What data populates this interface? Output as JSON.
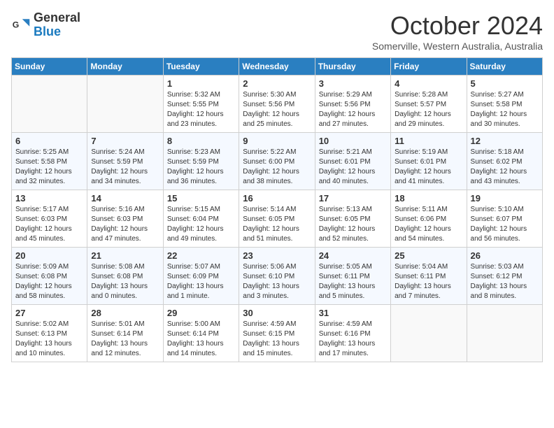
{
  "header": {
    "logo_general": "General",
    "logo_blue": "Blue",
    "month_title": "October 2024",
    "subtitle": "Somerville, Western Australia, Australia"
  },
  "days_of_week": [
    "Sunday",
    "Monday",
    "Tuesday",
    "Wednesday",
    "Thursday",
    "Friday",
    "Saturday"
  ],
  "weeks": [
    [
      {
        "day": "",
        "info": ""
      },
      {
        "day": "",
        "info": ""
      },
      {
        "day": "1",
        "info": "Sunrise: 5:32 AM\nSunset: 5:55 PM\nDaylight: 12 hours and 23 minutes."
      },
      {
        "day": "2",
        "info": "Sunrise: 5:30 AM\nSunset: 5:56 PM\nDaylight: 12 hours and 25 minutes."
      },
      {
        "day": "3",
        "info": "Sunrise: 5:29 AM\nSunset: 5:56 PM\nDaylight: 12 hours and 27 minutes."
      },
      {
        "day": "4",
        "info": "Sunrise: 5:28 AM\nSunset: 5:57 PM\nDaylight: 12 hours and 29 minutes."
      },
      {
        "day": "5",
        "info": "Sunrise: 5:27 AM\nSunset: 5:58 PM\nDaylight: 12 hours and 30 minutes."
      }
    ],
    [
      {
        "day": "6",
        "info": "Sunrise: 5:25 AM\nSunset: 5:58 PM\nDaylight: 12 hours and 32 minutes."
      },
      {
        "day": "7",
        "info": "Sunrise: 5:24 AM\nSunset: 5:59 PM\nDaylight: 12 hours and 34 minutes."
      },
      {
        "day": "8",
        "info": "Sunrise: 5:23 AM\nSunset: 5:59 PM\nDaylight: 12 hours and 36 minutes."
      },
      {
        "day": "9",
        "info": "Sunrise: 5:22 AM\nSunset: 6:00 PM\nDaylight: 12 hours and 38 minutes."
      },
      {
        "day": "10",
        "info": "Sunrise: 5:21 AM\nSunset: 6:01 PM\nDaylight: 12 hours and 40 minutes."
      },
      {
        "day": "11",
        "info": "Sunrise: 5:19 AM\nSunset: 6:01 PM\nDaylight: 12 hours and 41 minutes."
      },
      {
        "day": "12",
        "info": "Sunrise: 5:18 AM\nSunset: 6:02 PM\nDaylight: 12 hours and 43 minutes."
      }
    ],
    [
      {
        "day": "13",
        "info": "Sunrise: 5:17 AM\nSunset: 6:03 PM\nDaylight: 12 hours and 45 minutes."
      },
      {
        "day": "14",
        "info": "Sunrise: 5:16 AM\nSunset: 6:03 PM\nDaylight: 12 hours and 47 minutes."
      },
      {
        "day": "15",
        "info": "Sunrise: 5:15 AM\nSunset: 6:04 PM\nDaylight: 12 hours and 49 minutes."
      },
      {
        "day": "16",
        "info": "Sunrise: 5:14 AM\nSunset: 6:05 PM\nDaylight: 12 hours and 51 minutes."
      },
      {
        "day": "17",
        "info": "Sunrise: 5:13 AM\nSunset: 6:05 PM\nDaylight: 12 hours and 52 minutes."
      },
      {
        "day": "18",
        "info": "Sunrise: 5:11 AM\nSunset: 6:06 PM\nDaylight: 12 hours and 54 minutes."
      },
      {
        "day": "19",
        "info": "Sunrise: 5:10 AM\nSunset: 6:07 PM\nDaylight: 12 hours and 56 minutes."
      }
    ],
    [
      {
        "day": "20",
        "info": "Sunrise: 5:09 AM\nSunset: 6:08 PM\nDaylight: 12 hours and 58 minutes."
      },
      {
        "day": "21",
        "info": "Sunrise: 5:08 AM\nSunset: 6:08 PM\nDaylight: 13 hours and 0 minutes."
      },
      {
        "day": "22",
        "info": "Sunrise: 5:07 AM\nSunset: 6:09 PM\nDaylight: 13 hours and 1 minute."
      },
      {
        "day": "23",
        "info": "Sunrise: 5:06 AM\nSunset: 6:10 PM\nDaylight: 13 hours and 3 minutes."
      },
      {
        "day": "24",
        "info": "Sunrise: 5:05 AM\nSunset: 6:11 PM\nDaylight: 13 hours and 5 minutes."
      },
      {
        "day": "25",
        "info": "Sunrise: 5:04 AM\nSunset: 6:11 PM\nDaylight: 13 hours and 7 minutes."
      },
      {
        "day": "26",
        "info": "Sunrise: 5:03 AM\nSunset: 6:12 PM\nDaylight: 13 hours and 8 minutes."
      }
    ],
    [
      {
        "day": "27",
        "info": "Sunrise: 5:02 AM\nSunset: 6:13 PM\nDaylight: 13 hours and 10 minutes."
      },
      {
        "day": "28",
        "info": "Sunrise: 5:01 AM\nSunset: 6:14 PM\nDaylight: 13 hours and 12 minutes."
      },
      {
        "day": "29",
        "info": "Sunrise: 5:00 AM\nSunset: 6:14 PM\nDaylight: 13 hours and 14 minutes."
      },
      {
        "day": "30",
        "info": "Sunrise: 4:59 AM\nSunset: 6:15 PM\nDaylight: 13 hours and 15 minutes."
      },
      {
        "day": "31",
        "info": "Sunrise: 4:59 AM\nSunset: 6:16 PM\nDaylight: 13 hours and 17 minutes."
      },
      {
        "day": "",
        "info": ""
      },
      {
        "day": "",
        "info": ""
      }
    ]
  ]
}
